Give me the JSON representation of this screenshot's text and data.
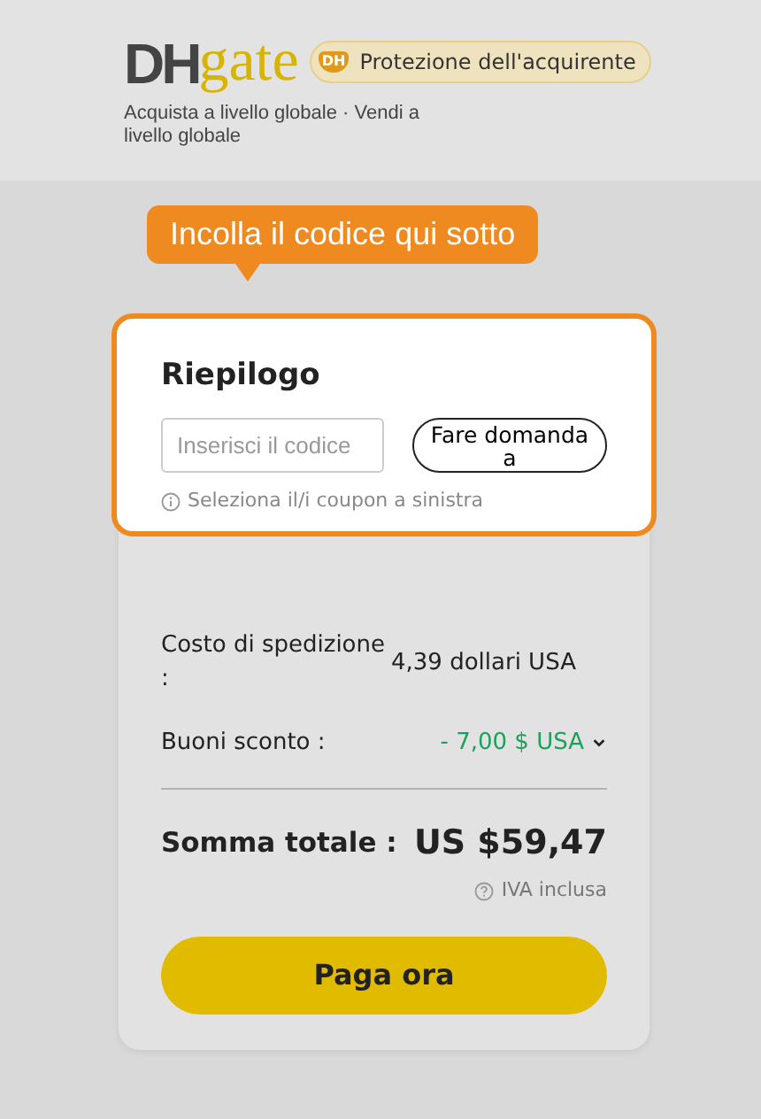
{
  "header": {
    "logo": {
      "dark": "DH",
      "yellow": "gate"
    },
    "protection_badge": {
      "icon_text": "DH",
      "label": "Protezione dell'acquirente"
    },
    "tagline": "Acquista a livello globale · Vendi a livello globale"
  },
  "tooltip": "Incolla il codice qui sotto",
  "coupon_card": {
    "title": "Riepilogo",
    "code_field": {
      "placeholder": "Inserisci il codice"
    },
    "apply_button": "Fare domanda a",
    "hint": "Seleziona il/i coupon a sinistra"
  },
  "summary": {
    "rows": [
      {
        "kind": "plain",
        "label": "Costo di spedizione :",
        "value": "4,39 dollari USA"
      },
      {
        "kind": "discount",
        "label": "Buoni sconto :",
        "value": "- 7,00 $ USA"
      }
    ],
    "total_label": "Somma totale :",
    "total_value": "US $59,47",
    "tax_note": "IVA inclusa",
    "pay_button": "Paga ora"
  }
}
